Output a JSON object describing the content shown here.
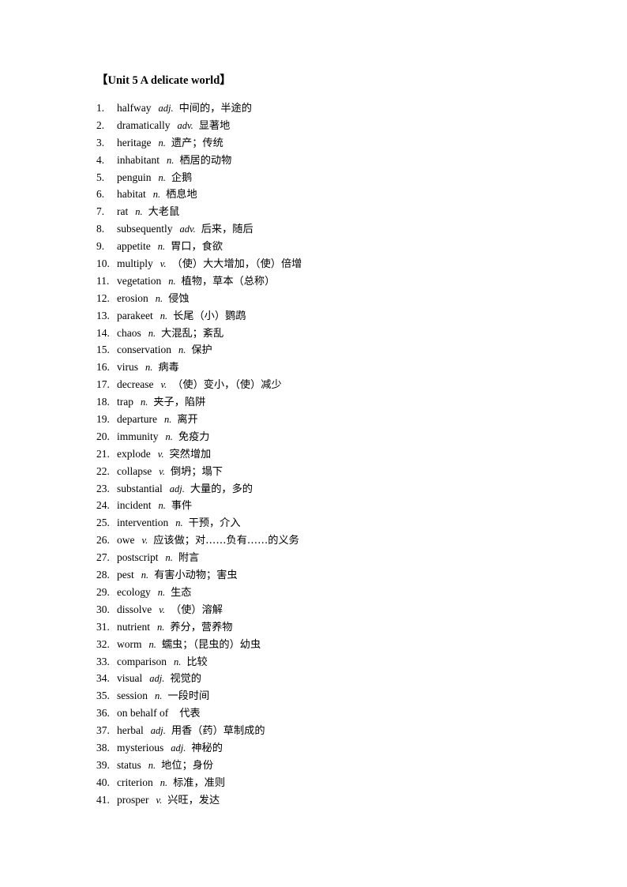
{
  "document": {
    "title_open_bracket": "【",
    "title_text": "Unit 5 A delicate world",
    "title_close_bracket": "】"
  },
  "vocabulary": {
    "items": [
      {
        "num": "1.",
        "word": "halfway",
        "pos": "adj.",
        "definition": "中间的，半途的"
      },
      {
        "num": "2.",
        "word": "dramatically",
        "pos": "adv.",
        "definition": "显著地"
      },
      {
        "num": "3.",
        "word": "heritage",
        "pos": "n.",
        "definition": "遗产；传统"
      },
      {
        "num": "4.",
        "word": "inhabitant",
        "pos": "n.",
        "definition": "栖居的动物"
      },
      {
        "num": "5.",
        "word": "penguin",
        "pos": "n.",
        "definition": "企鹅"
      },
      {
        "num": "6.",
        "word": "habitat",
        "pos": "n.",
        "definition": "栖息地"
      },
      {
        "num": "7.",
        "word": "rat",
        "pos": "n.",
        "definition": "大老鼠"
      },
      {
        "num": "8.",
        "word": "subsequently",
        "pos": "adv.",
        "definition": "后来，随后"
      },
      {
        "num": "9.",
        "word": "appetite",
        "pos": "n.",
        "definition": "胃口，食欲"
      },
      {
        "num": "10.",
        "word": "multiply",
        "pos": "v.",
        "definition": "（使）大大增加，（使）倍增"
      },
      {
        "num": "11.",
        "word": "vegetation",
        "pos": "n.",
        "definition": "植物，草本（总称）"
      },
      {
        "num": "12.",
        "word": "erosion",
        "pos": "n.",
        "definition": "侵蚀"
      },
      {
        "num": "13.",
        "word": "parakeet",
        "pos": "n.",
        "definition": "长尾（小）鹦鹉"
      },
      {
        "num": "14.",
        "word": "chaos",
        "pos": "n.",
        "definition": "大混乱；紊乱"
      },
      {
        "num": "15.",
        "word": "conservation",
        "pos": "n.",
        "definition": "保护"
      },
      {
        "num": "16.",
        "word": "virus",
        "pos": "n.",
        "definition": "病毒"
      },
      {
        "num": "17.",
        "word": "decrease",
        "pos": "v.",
        "definition": "（使）变小，（使）减少"
      },
      {
        "num": "18.",
        "word": "trap",
        "pos": "n.",
        "definition": "夹子，陷阱"
      },
      {
        "num": "19.",
        "word": "departure",
        "pos": "n.",
        "definition": "离开"
      },
      {
        "num": "20.",
        "word": "immunity",
        "pos": "n.",
        "definition": "免疫力"
      },
      {
        "num": "21.",
        "word": "explode",
        "pos": "v.",
        "definition": "突然增加"
      },
      {
        "num": "22.",
        "word": "collapse",
        "pos": "v.",
        "definition": "倒坍；塌下"
      },
      {
        "num": "23.",
        "word": "substantial",
        "pos": "adj.",
        "definition": "大量的，多的"
      },
      {
        "num": "24.",
        "word": "incident",
        "pos": "n.",
        "definition": "事件"
      },
      {
        "num": "25.",
        "word": "intervention",
        "pos": "n.",
        "definition": "干预，介入"
      },
      {
        "num": "26.",
        "word": "owe",
        "pos": "v.",
        "definition": "应该做；对……负有……的义务"
      },
      {
        "num": "27.",
        "word": "postscript",
        "pos": "n.",
        "definition": "附言"
      },
      {
        "num": "28.",
        "word": "pest",
        "pos": "n.",
        "definition": "有害小动物；害虫"
      },
      {
        "num": "29.",
        "word": "ecology",
        "pos": "n.",
        "definition": "生态"
      },
      {
        "num": "30.",
        "word": "dissolve",
        "pos": "v.",
        "definition": "（使）溶解"
      },
      {
        "num": "31.",
        "word": "nutrient",
        "pos": "n.",
        "definition": "养分，营养物"
      },
      {
        "num": "32.",
        "word": "worm",
        "pos": "n.",
        "definition": "蠕虫；（昆虫的）幼虫"
      },
      {
        "num": "33.",
        "word": "comparison",
        "pos": "n.",
        "definition": "比较"
      },
      {
        "num": "34.",
        "word": "visual",
        "pos": "adj.",
        "definition": "视觉的"
      },
      {
        "num": "35.",
        "word": "session",
        "pos": "n.",
        "definition": "一段时间"
      },
      {
        "num": "36.",
        "word": "on behalf of",
        "pos": "",
        "definition": "代表"
      },
      {
        "num": "37.",
        "word": "herbal",
        "pos": "adj.",
        "definition": "用香（药）草制成的"
      },
      {
        "num": "38.",
        "word": "mysterious",
        "pos": "adj.",
        "definition": "神秘的"
      },
      {
        "num": "39.",
        "word": "status",
        "pos": "n.",
        "definition": "地位；身份"
      },
      {
        "num": "40.",
        "word": "criterion",
        "pos": "n.",
        "definition": "标准，准则"
      },
      {
        "num": "41.",
        "word": "prosper",
        "pos": "v.",
        "definition": "兴旺，发达"
      }
    ]
  }
}
